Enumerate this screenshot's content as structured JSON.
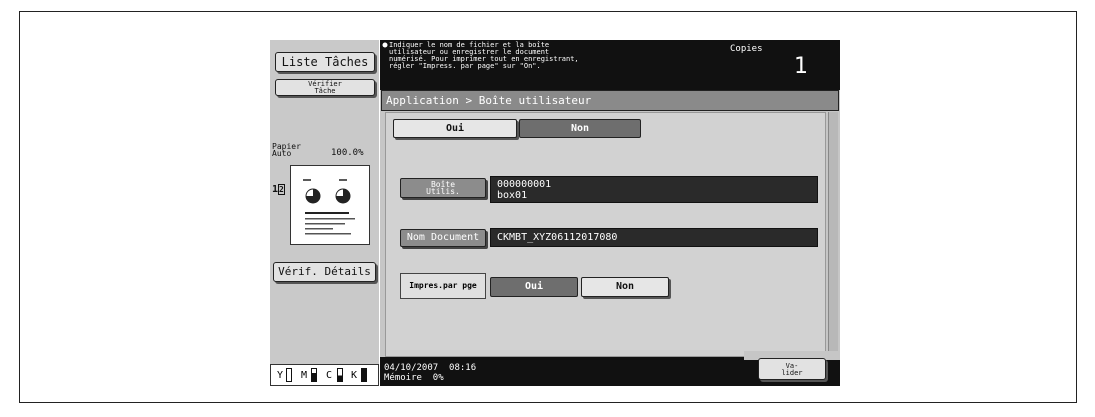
{
  "left_panel": {
    "liste_taches": "Liste Tâches",
    "verifier_tache_line1": "Vérifier",
    "verifier_tache_line2": "Tâche",
    "papier_label1": "Papier",
    "papier_label2": "Auto",
    "zoom": "100.0%",
    "verif_details": "Vérif. Détails",
    "toner": [
      "Y",
      "M",
      "C",
      "K"
    ]
  },
  "header": {
    "message_line1": "Indiquer le nom de fichier et la boîte",
    "message_line2": "utilisateur ou enregistrer le document",
    "message_line3": "numérisé. Pour imprimer tout en enregistrant,",
    "message_line4": "régler \"Impress. par page\" sur \"On\".",
    "copies_label": "Copies",
    "copies_value": "1"
  },
  "breadcrumb": "Application > Boîte utilisateur",
  "top_toggle": {
    "oui": "Oui",
    "non": "Non",
    "selected": "Non"
  },
  "boite": {
    "label_line1": "Boîte",
    "label_line2": "Utilis.",
    "value_line1": "000000001",
    "value_line2": "box01"
  },
  "nom_document": {
    "label": "Nom Document",
    "value": "CKMBT_XYZ06112017080"
  },
  "impres": {
    "label": "Impres.par pge",
    "oui": "Oui",
    "non": "Non",
    "selected": "Oui"
  },
  "footer": {
    "date": "04/10/2007",
    "time": "08:16",
    "memoire_label": "Mémoire",
    "memoire_value": "0%",
    "valider_line1": "Va-",
    "valider_line2": "lider"
  }
}
